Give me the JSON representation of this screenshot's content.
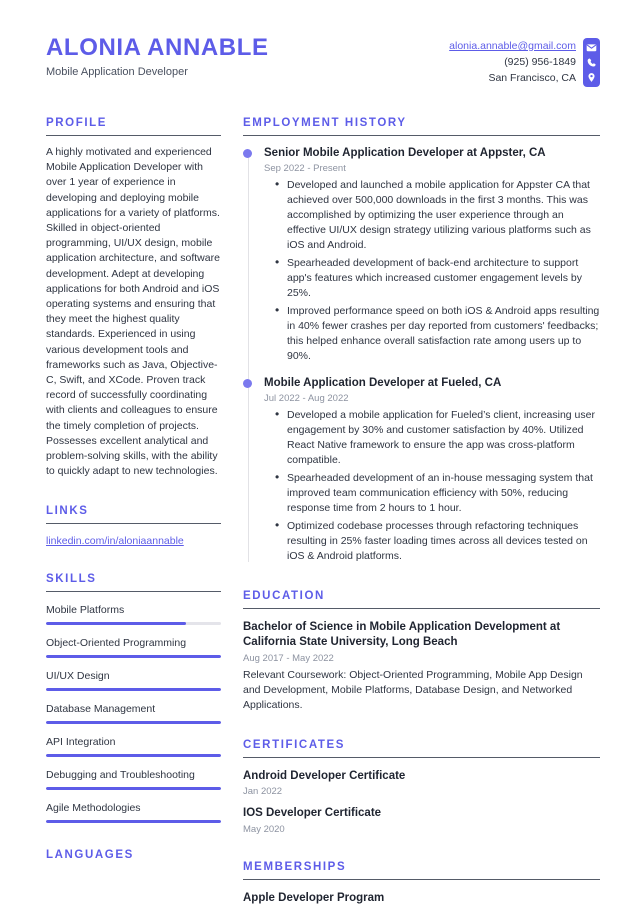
{
  "accent_color": "#5d5ce8",
  "header": {
    "name": "ALONIA ANNABLE",
    "job_title": "Mobile Application Developer",
    "email": "alonia.annable@gmail.com",
    "phone": "(925) 956-1849",
    "location": "San Francisco, CA"
  },
  "profile": {
    "heading": "PROFILE",
    "text": "A highly motivated and experienced Mobile Application Developer with over 1 year of experience in developing and deploying mobile applications for a variety of platforms. Skilled in object-oriented programming, UI/UX design, mobile application architecture, and software development. Adept at developing applications for both Android and iOS operating systems and ensuring that they meet the highest quality standards. Experienced in using various development tools and frameworks such as Java, Objective-C, Swift, and XCode. Proven track record of successfully coordinating with clients and colleagues to ensure the timely completion of projects. Possesses excellent analytical and problem-solving skills, with the ability to quickly adapt to new technologies."
  },
  "links": {
    "heading": "LINKS",
    "items": [
      {
        "label": "linkedin.com/in/aloniaannable"
      }
    ]
  },
  "skills": {
    "heading": "SKILLS",
    "items": [
      {
        "name": "Mobile Platforms",
        "level": 80
      },
      {
        "name": "Object-Oriented Programming",
        "level": 100
      },
      {
        "name": "UI/UX Design",
        "level": 100
      },
      {
        "name": "Database Management",
        "level": 100
      },
      {
        "name": "API Integration",
        "level": 100
      },
      {
        "name": "Debugging and Troubleshooting",
        "level": 100
      },
      {
        "name": "Agile Methodologies",
        "level": 100
      }
    ]
  },
  "languages": {
    "heading": "LANGUAGES"
  },
  "employment": {
    "heading": "EMPLOYMENT HISTORY",
    "jobs": [
      {
        "title": "Senior Mobile Application Developer at Appster, CA",
        "date": "Sep 2022 - Present",
        "bullets": [
          "Developed and launched a mobile application for Appster CA that achieved over 500,000 downloads in the first 3 months. This was accomplished by optimizing the user experience through an effective UI/UX design strategy utilizing various platforms such as iOS and Android.",
          "Spearheaded development of back-end architecture to support app's features which increased customer engagement levels by 25%.",
          "Improved performance speed on both iOS & Android apps resulting in 40% fewer crashes per day reported from customers' feedbacks; this helped enhance overall satisfaction rate among users up to 90%."
        ]
      },
      {
        "title": "Mobile Application Developer at Fueled, CA",
        "date": "Jul 2022 - Aug 2022",
        "bullets": [
          "Developed a mobile application for Fueled’s client, increasing user engagement by 30% and customer satisfaction by 40%. Utilized React Native framework to ensure the app was cross-platform compatible.",
          "Spearheaded development of an in-house messaging system that improved team communication efficiency with 50%, reducing response time from 2 hours to 1 hour.",
          "Optimized codebase processes through refactoring techniques resulting in 25% faster loading times across all devices tested on iOS & Android platforms."
        ]
      }
    ]
  },
  "education": {
    "heading": "EDUCATION",
    "entries": [
      {
        "title": "Bachelor of Science in Mobile Application Development at California State University, Long Beach",
        "date": "Aug 2017 - May 2022",
        "description": "Relevant Coursework: Object-Oriented Programming, Mobile App Design and Development, Mobile Platforms, Database Design, and Networked Applications."
      }
    ]
  },
  "certificates": {
    "heading": "CERTIFICATES",
    "entries": [
      {
        "title": "Android Developer Certificate",
        "date": "Jan 2022"
      },
      {
        "title": "IOS Developer Certificate",
        "date": "May 2020"
      }
    ]
  },
  "memberships": {
    "heading": "MEMBERSHIPS",
    "entries": [
      {
        "title": "Apple Developer Program"
      }
    ]
  }
}
